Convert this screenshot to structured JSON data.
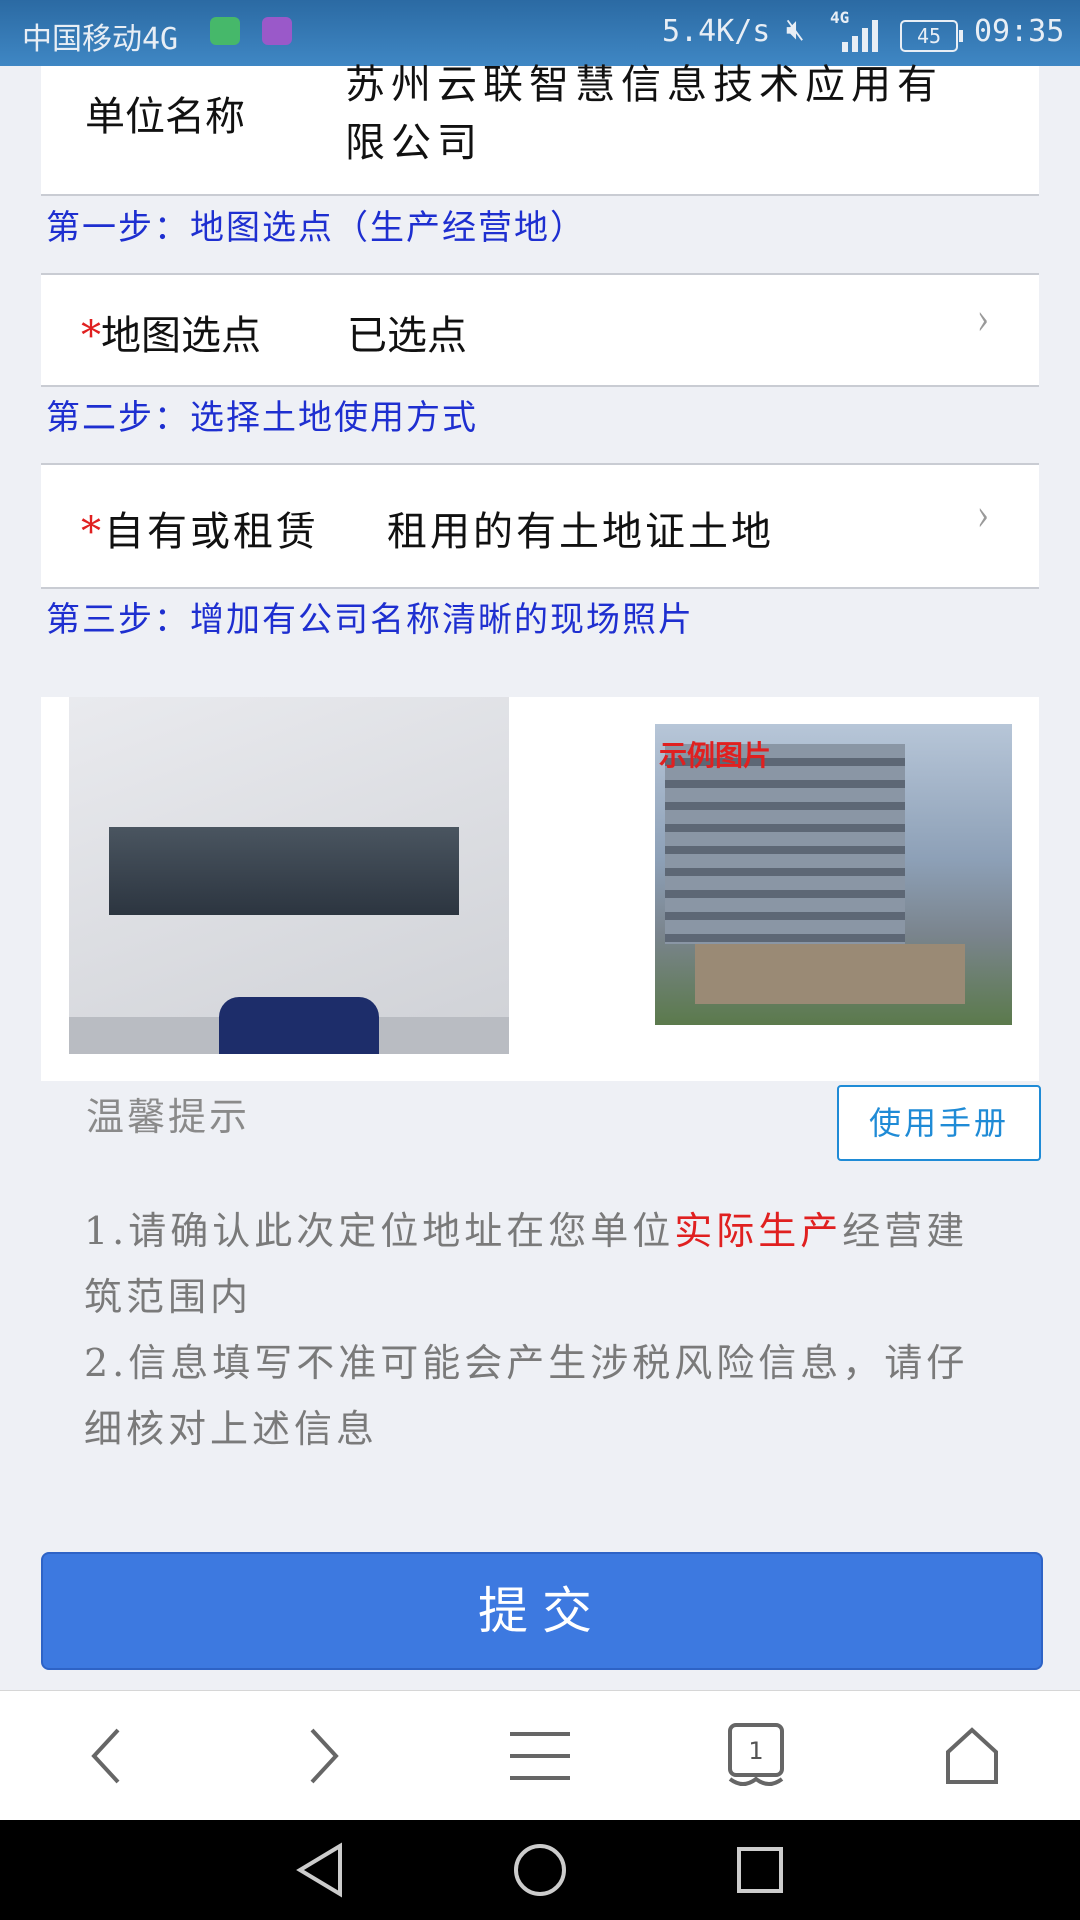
{
  "status_bar": {
    "carrier": "中国移动4G",
    "speed": "5.4K/s",
    "network": "4G",
    "battery": "45",
    "time": "09:35"
  },
  "company": {
    "label": "单位名称",
    "value_line1": "苏州云联智慧信息技术应用有",
    "value_line2": "限公司"
  },
  "step1": {
    "title": "第一步：地图选点（生产经营地）"
  },
  "map_pick": {
    "required_mark": "*",
    "label": "地图选点",
    "value": "已选点"
  },
  "step2": {
    "title": "第二步：选择土地使用方式"
  },
  "land_use": {
    "required_mark": "*",
    "label": "自有或租赁",
    "value": "租用的有土地证土地"
  },
  "step3": {
    "title": "第三步：增加有公司名称清晰的现场照片"
  },
  "photos": {
    "example_caption": "示例图片"
  },
  "tips": {
    "title": "温馨提示",
    "manual_button": "使用手册",
    "line1_before": "1.请确认此次定位地址在您单位",
    "line1_highlight": "实际生产",
    "line1_after": "经营建筑范围内",
    "line2": "2.信息填写不准可能会产生涉税风险信息，请仔细核对上述信息"
  },
  "submit_label": "提交",
  "browser_bar": {
    "tab_count": "1"
  },
  "colors": {
    "accent": "#3d79e0",
    "step_text": "#1e2fd0",
    "required": "#e02020",
    "link_blue": "#1f8bd6"
  }
}
